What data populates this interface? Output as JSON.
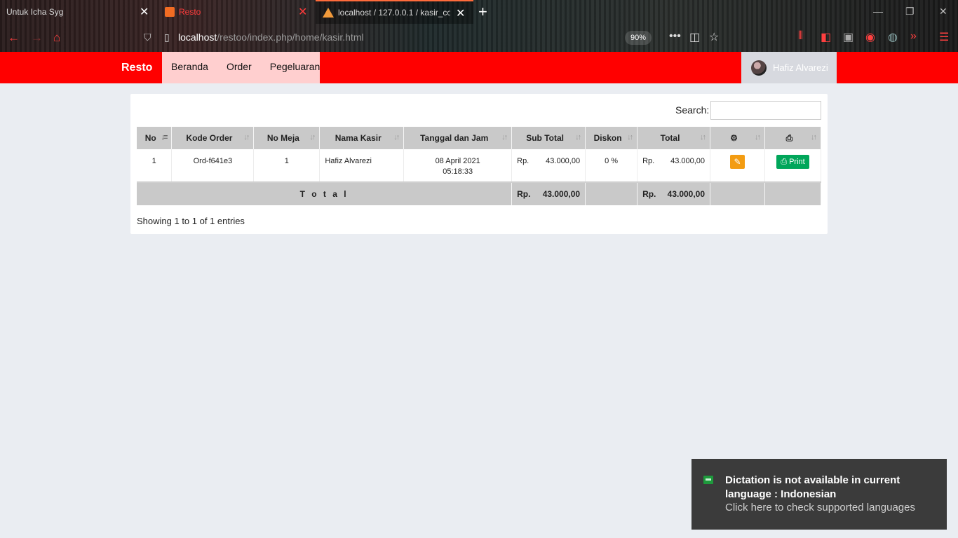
{
  "browser": {
    "tabs": [
      {
        "label": "Untuk Icha Syg",
        "active": false
      },
      {
        "label": "Resto",
        "active": false
      },
      {
        "label": "localhost / 127.0.0.1 / kasir_cof",
        "active": true
      }
    ],
    "url_host": "localhost",
    "url_path": "/restoo/index.php/home/kasir.html",
    "zoom": "90%"
  },
  "app": {
    "brand": "Resto",
    "menu": [
      "Beranda",
      "Order",
      "Pegeluaran"
    ],
    "user": "Hafiz Alvarezi"
  },
  "search": {
    "label": "Search:",
    "value": ""
  },
  "table": {
    "headers": [
      "No",
      "Kode Order",
      "No Meja",
      "Nama Kasir",
      "Tanggal dan Jam",
      "Sub Total",
      "Diskon",
      "Total"
    ],
    "rows": [
      {
        "no": "1",
        "kode_order": "Ord-f641e3",
        "no_meja": "1",
        "nama_kasir": "Hafiz Alvarezi",
        "tanggal": "08 April 2021",
        "jam": "05:18:33",
        "sub_total_cur": "Rp.",
        "sub_total": "43.000,00",
        "diskon": "0 %",
        "total_cur": "Rp.",
        "total": "43.000,00",
        "print_label": "Print"
      }
    ],
    "footer": {
      "label": "T o t a l",
      "sub_total_cur": "Rp.",
      "sub_total": "43.000,00",
      "total_cur": "Rp.",
      "total": "43.000,00"
    },
    "info": "Showing 1 to 1 of 1 entries"
  },
  "toast": {
    "title": "Dictation is not available in current language : Indonesian",
    "subtitle": "Click here to check supported languages"
  },
  "colors": {
    "navbar": "#ff0000",
    "menu_bg": "#ffcfcf",
    "edit": "#f39c12",
    "print": "#00a65a"
  }
}
